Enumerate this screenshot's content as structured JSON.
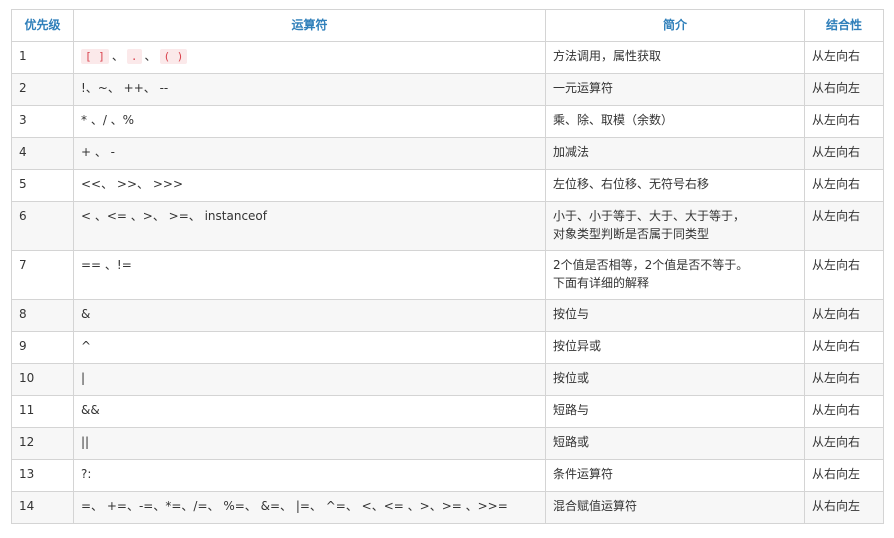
{
  "table": {
    "headers": [
      "优先级",
      "运算符",
      "简介",
      "结合性"
    ],
    "row1": {
      "priority": "1",
      "op_code": [
        "[ ]",
        ".",
        "( )"
      ],
      "op_seps": [
        "、",
        "、"
      ],
      "desc": "方法调用，属性获取",
      "assoc": "从左向右"
    },
    "rows": [
      {
        "priority": "2",
        "op": "!、~、 ++、 --",
        "desc": "一元运算符",
        "assoc": "从右向左"
      },
      {
        "priority": "3",
        "op": "* 、/ 、%",
        "desc": "乘、除、取模（余数）",
        "assoc": "从左向右"
      },
      {
        "priority": "4",
        "op": "+ 、 -",
        "desc": "加减法",
        "assoc": "从左向右"
      },
      {
        "priority": "5",
        "op": "<<、 >>、 >>>",
        "desc": "左位移、右位移、无符号右移",
        "assoc": "从左向右"
      },
      {
        "priority": "6",
        "op": "< 、<= 、>、 >=、 instanceof",
        "desc": "小于、小于等于、大于、大于等于，\n对象类型判断是否属于同类型",
        "assoc": "从左向右"
      },
      {
        "priority": "7",
        "op": "== 、!=",
        "desc": "2个值是否相等，2个值是否不等于。\n下面有详细的解释",
        "assoc": "从左向右"
      },
      {
        "priority": "8",
        "op": "&",
        "desc": "按位与",
        "assoc": "从左向右"
      },
      {
        "priority": "9",
        "op": "^",
        "desc": "按位异或",
        "assoc": "从左向右"
      },
      {
        "priority": "10",
        "op": "|",
        "desc": "按位或",
        "assoc": "从左向右"
      },
      {
        "priority": "11",
        "op": "&&",
        "desc": "短路与",
        "assoc": "从左向右"
      },
      {
        "priority": "12",
        "op": "||",
        "desc": "短路或",
        "assoc": "从左向右"
      },
      {
        "priority": "13",
        "op": "?:",
        "desc": "条件运算符",
        "assoc": "从右向左"
      },
      {
        "priority": "14",
        "op": "=、 +=、-=、*=、/=、 %=、 &=、 |=、 ^=、 <、<= 、>、>= 、>>=",
        "desc": "混合赋值运算符",
        "assoc": "从右向左"
      }
    ]
  }
}
